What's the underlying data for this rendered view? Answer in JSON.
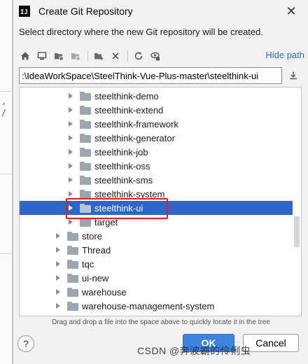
{
  "window": {
    "title": "Create Git Repository",
    "app_icon_text": "IJ",
    "close_glyph": "✕"
  },
  "description": "Select directory where the new Git repository will be created.",
  "toolbar": {
    "icons": [
      "home-icon",
      "desktop-icon",
      "project-folder-icon",
      "module-folder-icon",
      "new-folder-icon",
      "delete-icon",
      "refresh-icon",
      "show-hidden-icon"
    ],
    "hide_path_label": "Hide path"
  },
  "path": {
    "value": ":\\IdeaWorkSpace\\SteelThink-Vue-Plus-master\\steelthink-ui"
  },
  "tree": {
    "items": [
      {
        "label": "steelthink-demo",
        "level": 1,
        "expandable": true,
        "selected": false
      },
      {
        "label": "steelthink-extend",
        "level": 1,
        "expandable": true,
        "selected": false
      },
      {
        "label": "steelthink-framework",
        "level": 1,
        "expandable": true,
        "selected": false
      },
      {
        "label": "steelthink-generator",
        "level": 1,
        "expandable": true,
        "selected": false
      },
      {
        "label": "steelthink-job",
        "level": 1,
        "expandable": true,
        "selected": false
      },
      {
        "label": "steelthink-oss",
        "level": 1,
        "expandable": true,
        "selected": false
      },
      {
        "label": "steelthink-sms",
        "level": 1,
        "expandable": true,
        "selected": false
      },
      {
        "label": "steelthink-system",
        "level": 1,
        "expandable": true,
        "selected": false
      },
      {
        "label": "steelthink-ui",
        "level": 1,
        "expandable": true,
        "selected": true
      },
      {
        "label": "target",
        "level": 1,
        "expandable": true,
        "selected": false
      },
      {
        "label": "store",
        "level": 0,
        "expandable": true,
        "selected": false
      },
      {
        "label": "Thread",
        "level": 0,
        "expandable": true,
        "selected": false
      },
      {
        "label": "tqc",
        "level": 0,
        "expandable": true,
        "selected": false
      },
      {
        "label": "ui-new",
        "level": 0,
        "expandable": true,
        "selected": false
      },
      {
        "label": "warehouse",
        "level": 0,
        "expandable": true,
        "selected": false
      },
      {
        "label": "warehouse-management-system",
        "level": 0,
        "expandable": true,
        "selected": false
      }
    ]
  },
  "hint": "Drag and drop a file into the space above to quickly locate it in the tree",
  "buttons": {
    "help": "?",
    "ok": "OK",
    "cancel": "Cancel"
  },
  "watermark": "CSDN @奔波霸的伶俐虫",
  "colors": {
    "selection": "#2f65ca",
    "highlight_box": "#e02020",
    "link": "#2a6fc9",
    "ok_button": "#3d84e0"
  }
}
